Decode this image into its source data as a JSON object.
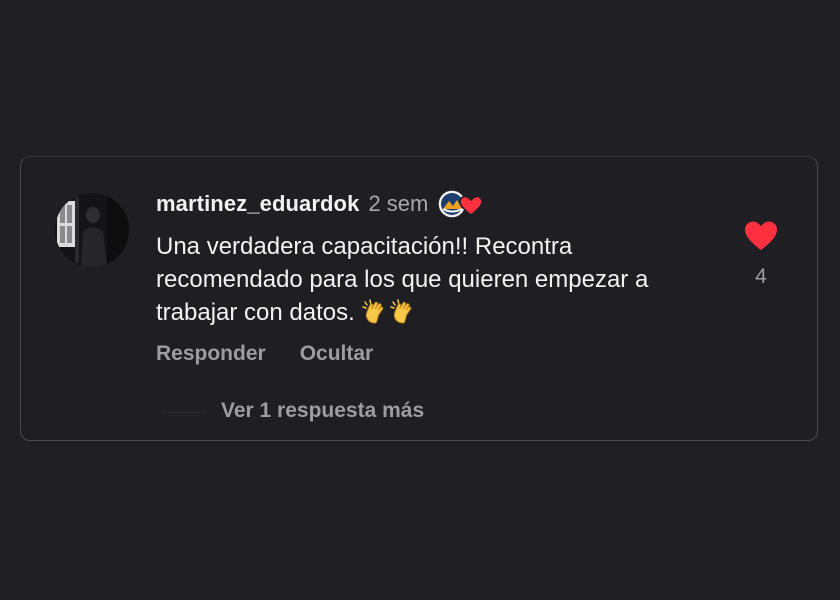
{
  "comment": {
    "username": "martinez_eduardok",
    "time": "2 sem",
    "text": "Una verdadera capacitación!! Recontra recomendado para los que quieren empezar a trabajar con datos.",
    "emojis": [
      "clapping-hands-icon",
      "clapping-hands-icon"
    ],
    "like_count": "4",
    "liked": true
  },
  "actions": {
    "reply_label": "Responder",
    "hide_label": "Ocultar",
    "more_replies_label": "Ver 1 respuesta más"
  },
  "colors": {
    "background": "#202024",
    "text": "#f2f2f2",
    "muted": "#9c9ca1",
    "heart": "#ff3040"
  }
}
